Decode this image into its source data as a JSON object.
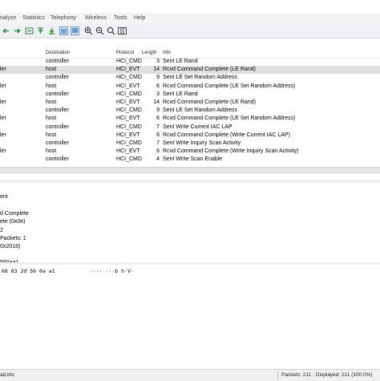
{
  "menu": [
    "nalyze",
    "Statistics",
    "Telephony",
    "Wireless",
    "Tools",
    "Help"
  ],
  "columns": {
    "destination": "Destination",
    "protocol": "Protocol",
    "length": "Length",
    "info": "Info"
  },
  "packets": [
    {
      "source": "",
      "destination": "controller",
      "protocol": "HCI_CMD",
      "length": "3",
      "info": "Sent LE Rand",
      "selected": false
    },
    {
      "source": "ler",
      "destination": "host",
      "protocol": "HCI_EVT",
      "length": "14",
      "info": "Rcvd Command Complete (LE Rand)",
      "selected": true
    },
    {
      "source": "",
      "destination": "controller",
      "protocol": "HCI_CMD",
      "length": "9",
      "info": "Sent LE Set Random Address",
      "selected": false
    },
    {
      "source": "ler",
      "destination": "host",
      "protocol": "HCI_EVT",
      "length": "6",
      "info": "Rcvd Command Complete (LE Set Random Address)",
      "selected": false
    },
    {
      "source": "",
      "destination": "controller",
      "protocol": "HCI_CMD",
      "length": "3",
      "info": "Sent LE Rand",
      "selected": false
    },
    {
      "source": "ler",
      "destination": "host",
      "protocol": "HCI_EVT",
      "length": "14",
      "info": "Rcvd Command Complete (LE Rand)",
      "selected": false
    },
    {
      "source": "",
      "destination": "controller",
      "protocol": "HCI_CMD",
      "length": "9",
      "info": "Sent LE Set Random Address",
      "selected": false
    },
    {
      "source": "ler",
      "destination": "host",
      "protocol": "HCI_EVT",
      "length": "6",
      "info": "Rcvd Command Complete (LE Set Random Address)",
      "selected": false
    },
    {
      "source": "",
      "destination": "controller",
      "protocol": "HCI_CMD",
      "length": "7",
      "info": "Sent Write Current IAC LAP",
      "selected": false
    },
    {
      "source": "ler",
      "destination": "host",
      "protocol": "HCI_EVT",
      "length": "6",
      "info": "Rcvd Command Complete (Write Current IAC LAP)",
      "selected": false
    },
    {
      "source": "",
      "destination": "controller",
      "protocol": "HCI_CMD",
      "length": "7",
      "info": "Sent Write Inquiry Scan Activity",
      "selected": false
    },
    {
      "source": "ler",
      "destination": "host",
      "protocol": "HCI_EVT",
      "length": "6",
      "info": "Rcvd Command Complete (Write Inquiry Scan Activity)",
      "selected": false
    },
    {
      "source": "",
      "destination": "controller",
      "protocol": "HCI_CMD",
      "length": "4",
      "info": "Sent Write Scan Enable",
      "selected": false
    }
  ],
  "details": [
    "ent",
    "d Complete",
    "ete (0x0e)",
    "2",
    " Packets: 1",
    "0x2018)",
    "560aa1"
  ],
  "bytes": {
    "hex": "68 83 2d 56 0a a1",
    "ascii": "···· ···b h·V·"
  },
  "status": {
    "file": "ad.bts",
    "packets": "Packets: 211 · Displayed: 211 (100.0%)"
  },
  "colors": {
    "selected_row": "#e0e0e0",
    "toolbar_bg": "#eef0f4",
    "accent_icon": "#1e6fb8"
  }
}
